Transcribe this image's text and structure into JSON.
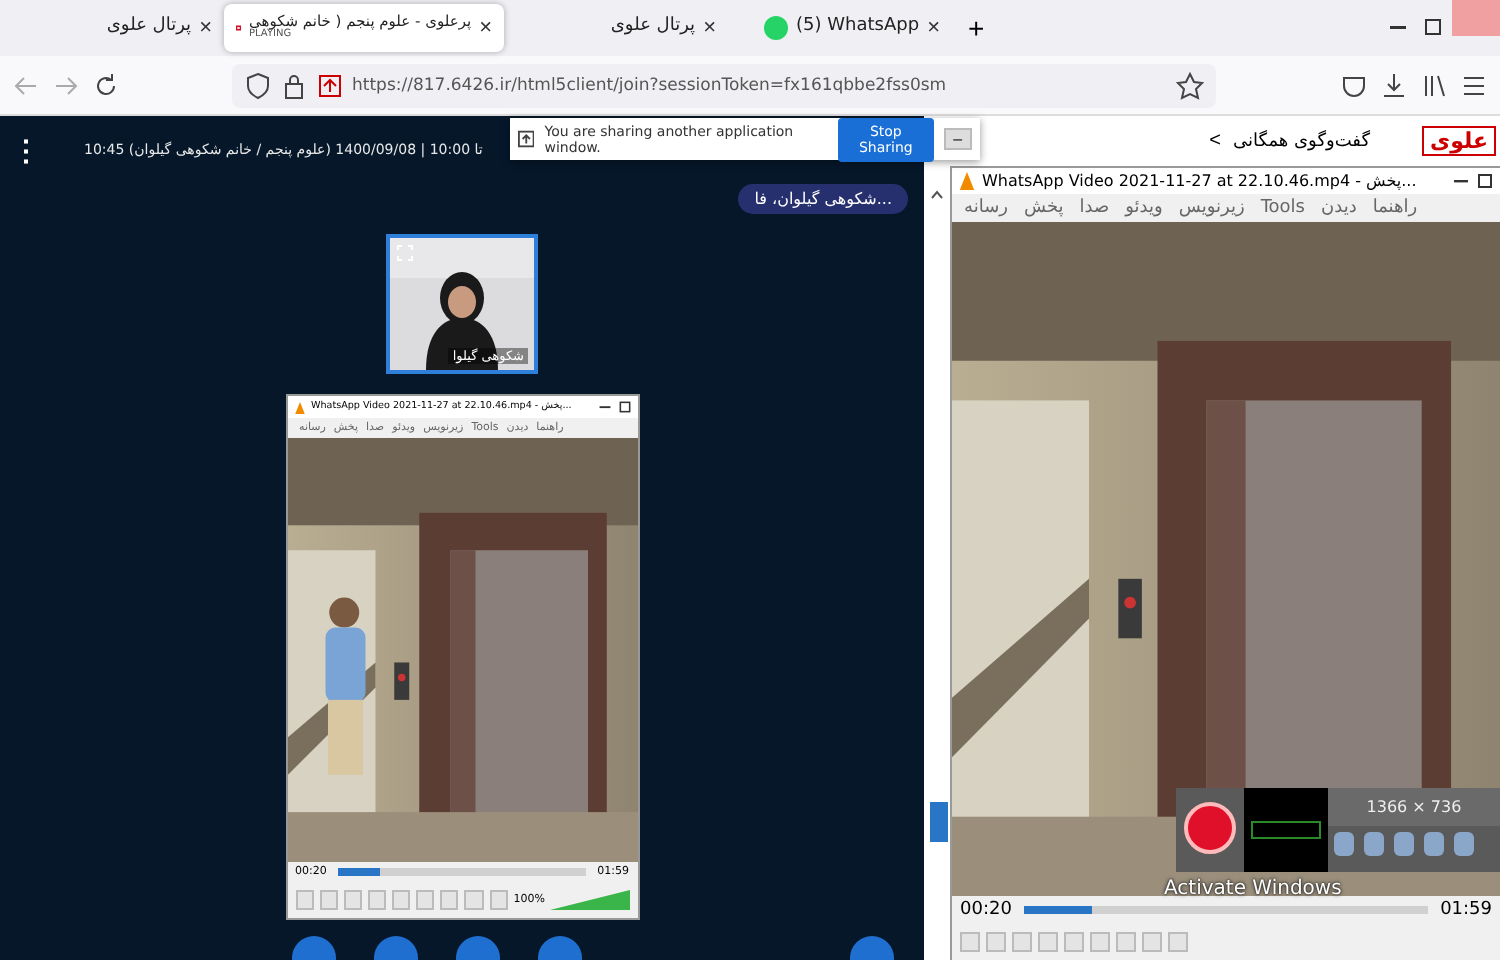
{
  "browser": {
    "tabs": [
      {
        "title": "(5) WhatsApp",
        "selected": false,
        "kind": "chat"
      },
      {
        "title": "پرتال علوی",
        "selected": false,
        "kind": "plain"
      },
      {
        "title": "پرعلوی - علوم پنجم ( خانم شکوهی",
        "subtitle": "PLAYING",
        "selected": true,
        "kind": "meeting"
      },
      {
        "title": "پرتال علوی",
        "selected": false,
        "kind": "plain"
      }
    ],
    "close": "×",
    "new_tab": "+",
    "url": "https://817.6426.ir/html5client/join?sessionToken=fx161qbbe2fss0sm"
  },
  "meeting": {
    "menu": "⋮",
    "title": "10:45 تا 10:00 | 1400/09/08 (علوم پنجم / خانم شکوهی گیلوان)",
    "talking": "شکوهی گیلوان، فا...",
    "webcam_name": "شکوهی گیلوا"
  },
  "share_banner": {
    "message": "You are sharing another application window.",
    "button": "Stop Sharing",
    "minimize": "–"
  },
  "shared_player": {
    "title": "WhatsApp Video 2021-11-27 at 22.10.46.mp4 - پخش...",
    "menu": [
      "راهنما",
      "دیدن",
      "Tools",
      "زیرنویس",
      "ویدئو",
      "صدا",
      "پخش",
      "رسانه"
    ],
    "elapsed": "00:20",
    "total": "01:59",
    "level": 0.17,
    "volume": "100%"
  },
  "chat": {
    "logo": "علوی",
    "back": "<",
    "title": "گفت‌وگوی همگانی"
  },
  "player": {
    "title": "WhatsApp Video 2021-11-27 at 22.10.46.mp4 - پخش...",
    "menu": [
      "راهنما",
      "دیدن",
      "Tools",
      "زیرنویس",
      "ویدئو",
      "صدا",
      "پخش",
      "رسانه"
    ],
    "elapsed": "00:20",
    "total": "01:59",
    "level": 0.17
  },
  "recorder": {
    "resolution": "1366 × 736"
  },
  "os_notice": "Activate Windows"
}
